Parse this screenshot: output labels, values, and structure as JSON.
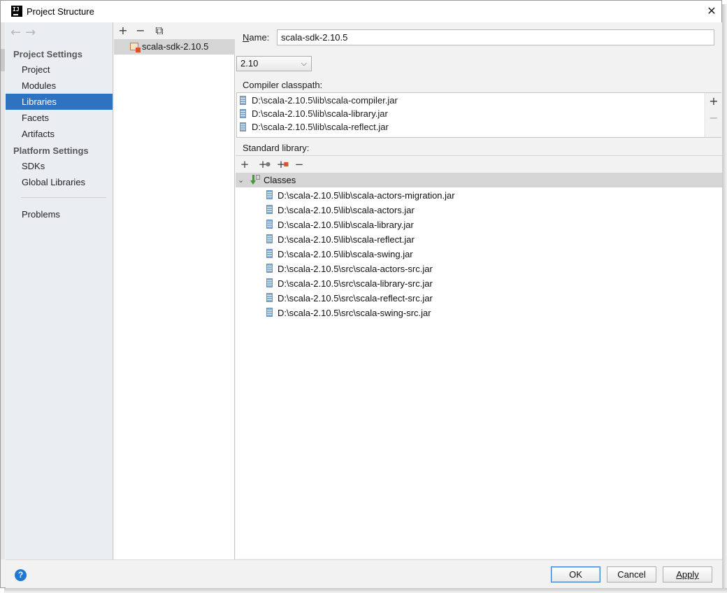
{
  "window": {
    "title": "Project Structure",
    "close_glyph": "✕"
  },
  "nav": {
    "back_glyph": "←",
    "forward_glyph": "→",
    "project_settings_heading": "Project Settings",
    "project_items": [
      "Project",
      "Modules",
      "Libraries",
      "Facets",
      "Artifacts"
    ],
    "platform_settings_heading": "Platform Settings",
    "platform_items": [
      "SDKs",
      "Global Libraries"
    ],
    "problems": "Problems",
    "selected": "Libraries"
  },
  "libraries": {
    "toolbar": {
      "add": "+",
      "remove": "−",
      "copy": "⧉"
    },
    "items": [
      "scala-sdk-2.10.5"
    ]
  },
  "detail": {
    "name_label": "Name:",
    "name_value": "scala-sdk-2.10.5",
    "version": "2.10",
    "compiler_classpath_label": "Compiler classpath:",
    "compiler_classpath": [
      "D:\\scala-2.10.5\\lib\\scala-compiler.jar",
      "D:\\scala-2.10.5\\lib\\scala-library.jar",
      "D:\\scala-2.10.5\\lib\\scala-reflect.jar"
    ],
    "classpath_add": "+",
    "classpath_remove": "−",
    "standard_library_label": "Standard library:",
    "std_toolbar": {
      "add": "+",
      "add_alt": "+",
      "add_src": "+",
      "remove": "−"
    },
    "classes_label": "Classes",
    "classes": [
      "D:\\scala-2.10.5\\lib\\scala-actors-migration.jar",
      "D:\\scala-2.10.5\\lib\\scala-actors.jar",
      "D:\\scala-2.10.5\\lib\\scala-library.jar",
      "D:\\scala-2.10.5\\lib\\scala-reflect.jar",
      "D:\\scala-2.10.5\\lib\\scala-swing.jar",
      "D:\\scala-2.10.5\\src\\scala-actors-src.jar",
      "D:\\scala-2.10.5\\src\\scala-library-src.jar",
      "D:\\scala-2.10.5\\src\\scala-reflect-src.jar",
      "D:\\scala-2.10.5\\src\\scala-swing-src.jar"
    ]
  },
  "footer": {
    "help": "?",
    "ok": "OK",
    "cancel": "Cancel",
    "apply": "Apply"
  },
  "colors": {
    "selection": "#2f73c0",
    "nav_bg": "#eaedf1",
    "panel_bg": "#f2f2f2"
  }
}
